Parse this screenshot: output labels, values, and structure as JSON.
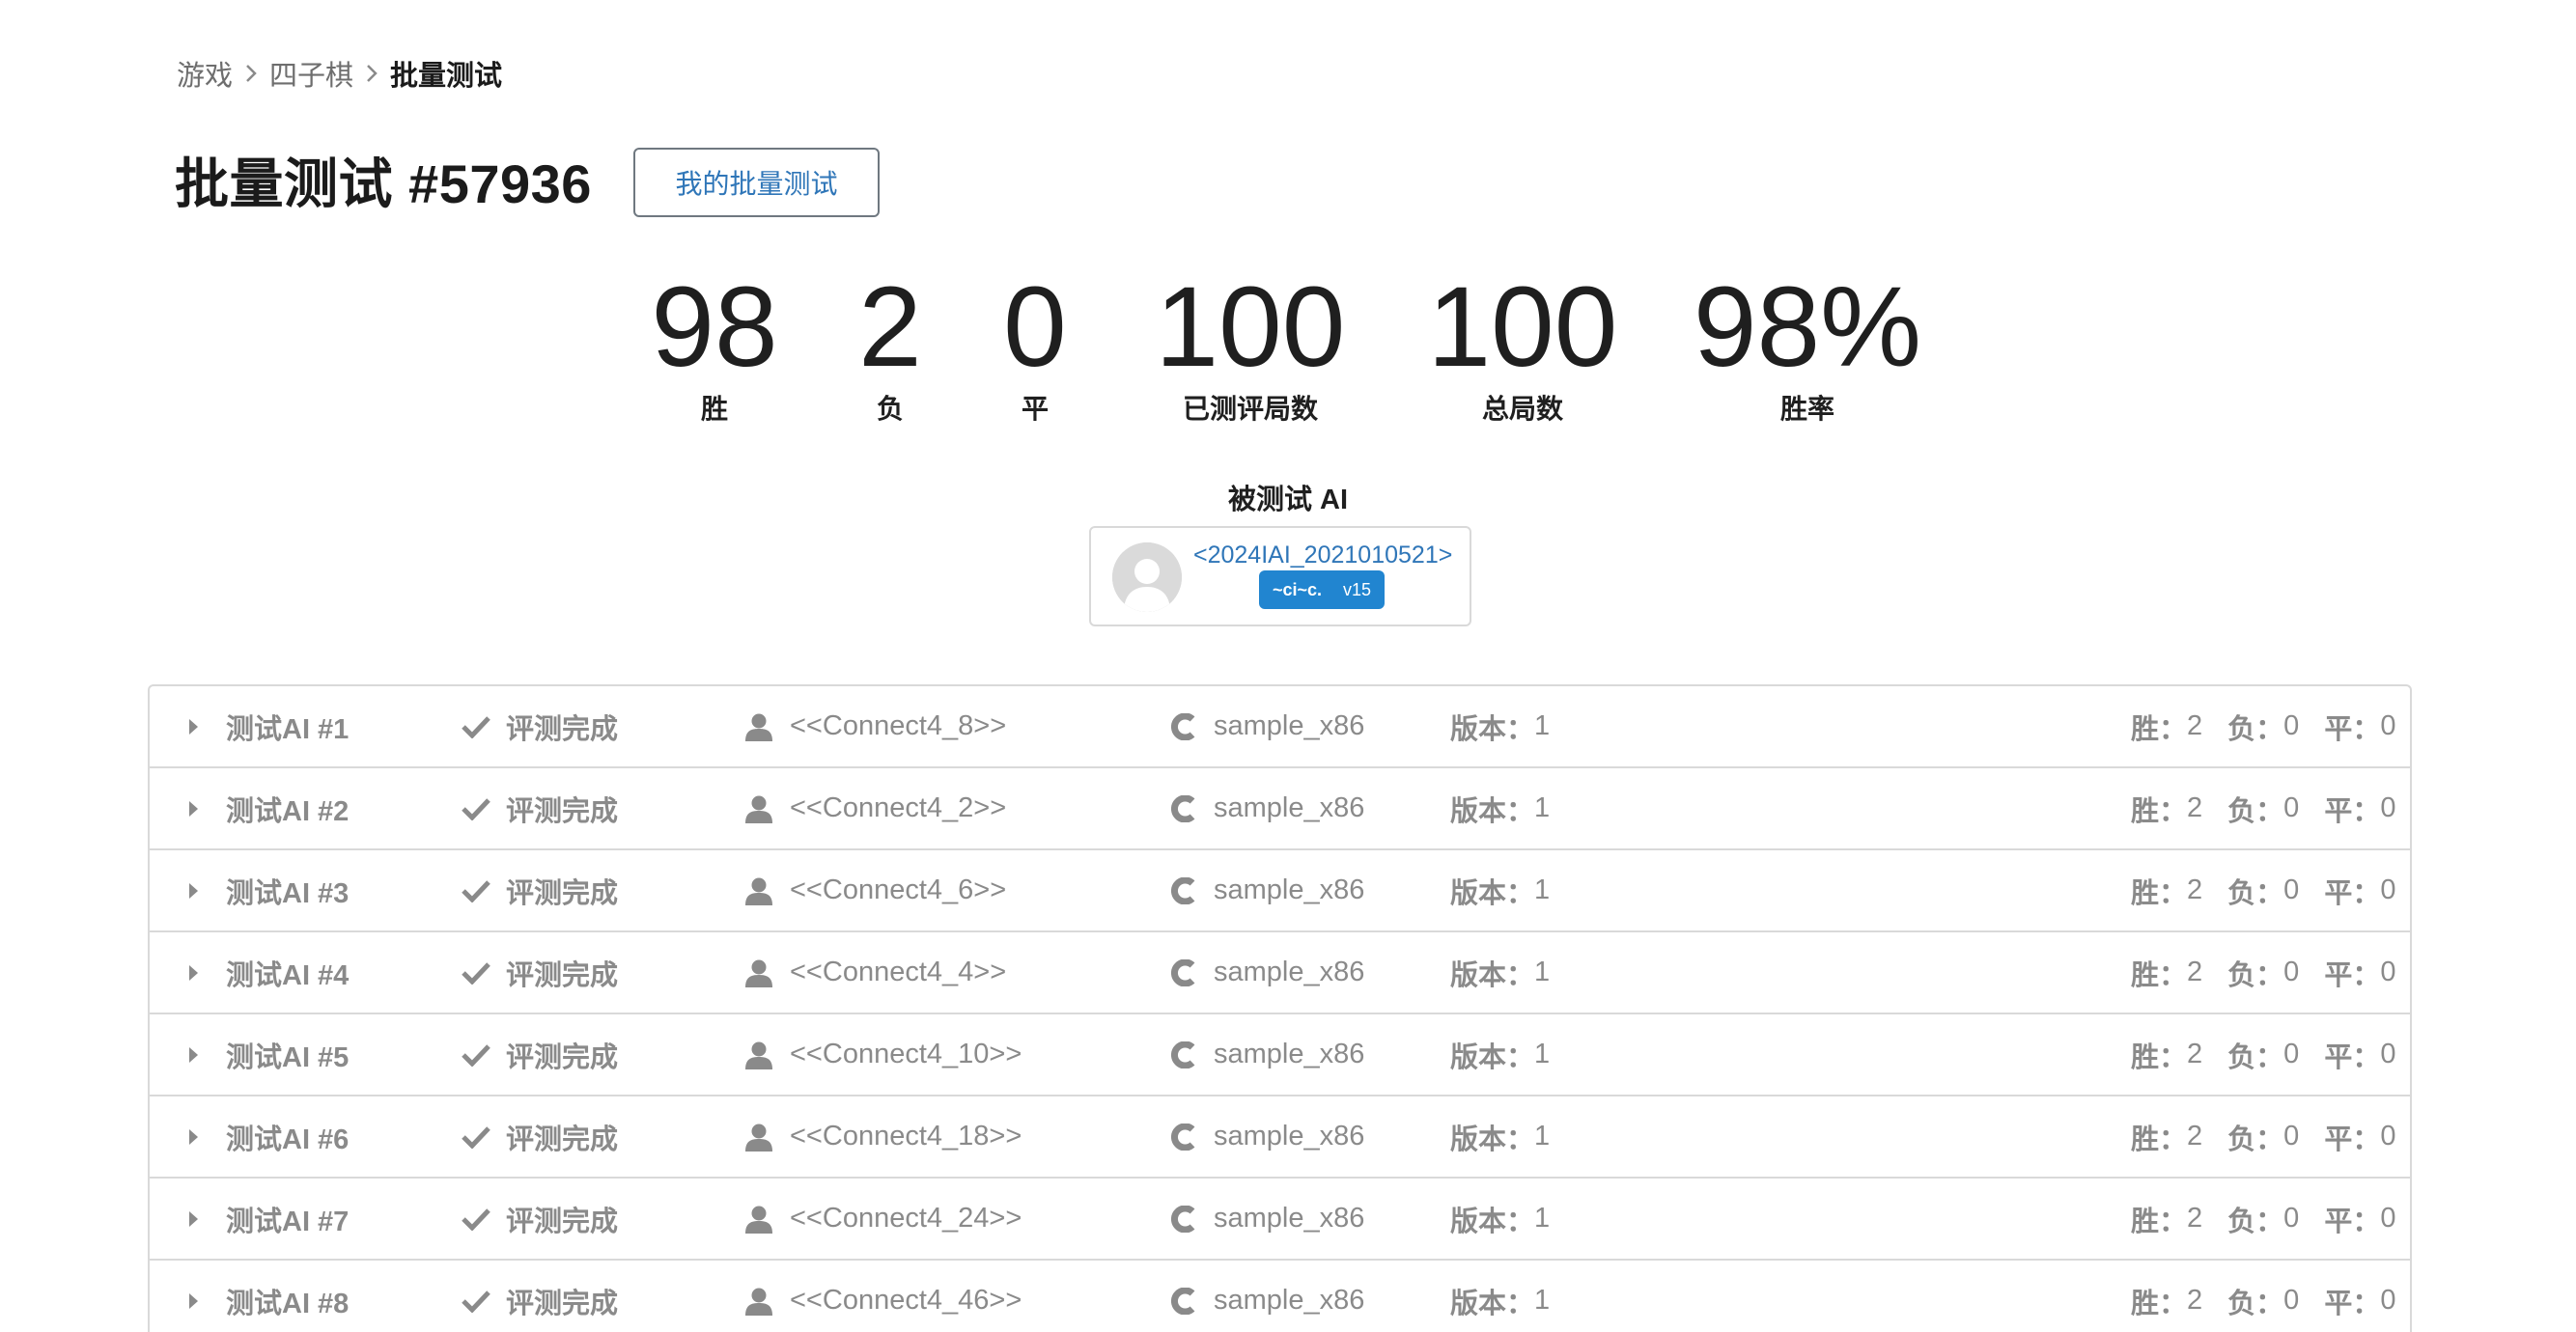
{
  "breadcrumb": {
    "items": [
      "游戏",
      "四子棋",
      "批量测试"
    ]
  },
  "header": {
    "title": "批量测试 #57936",
    "my_tests_label": "我的批量测试"
  },
  "stats": [
    {
      "value": "98",
      "label": "胜"
    },
    {
      "value": "2",
      "label": "负"
    },
    {
      "value": "0",
      "label": "平"
    },
    {
      "value": "100",
      "label": "已测评局数"
    },
    {
      "value": "100",
      "label": "总局数"
    },
    {
      "value": "98%",
      "label": "胜率"
    }
  ],
  "tested_ai": {
    "heading": "被测试 AI",
    "name": "<2024IAI_2021010521>",
    "tag": "~ci~c.",
    "version": "v15"
  },
  "colors": {
    "link": "#2f76b8",
    "tag_bg": "#2185d0",
    "muted_text": "#8a8a8a",
    "border": "#d9d9d9"
  },
  "rows": [
    {
      "label": "测试AI #1",
      "status": "评测完成",
      "opponent": "<<Connect4_8>>",
      "lang": "sample_x86",
      "version_label": "版本：",
      "version": "1",
      "win_label": "胜：",
      "win": "2",
      "lose_label": "负：",
      "lose": "0",
      "draw_label": "平：",
      "draw": "0"
    },
    {
      "label": "测试AI #2",
      "status": "评测完成",
      "opponent": "<<Connect4_2>>",
      "lang": "sample_x86",
      "version_label": "版本：",
      "version": "1",
      "win_label": "胜：",
      "win": "2",
      "lose_label": "负：",
      "lose": "0",
      "draw_label": "平：",
      "draw": "0"
    },
    {
      "label": "测试AI #3",
      "status": "评测完成",
      "opponent": "<<Connect4_6>>",
      "lang": "sample_x86",
      "version_label": "版本：",
      "version": "1",
      "win_label": "胜：",
      "win": "2",
      "lose_label": "负：",
      "lose": "0",
      "draw_label": "平：",
      "draw": "0"
    },
    {
      "label": "测试AI #4",
      "status": "评测完成",
      "opponent": "<<Connect4_4>>",
      "lang": "sample_x86",
      "version_label": "版本：",
      "version": "1",
      "win_label": "胜：",
      "win": "2",
      "lose_label": "负：",
      "lose": "0",
      "draw_label": "平：",
      "draw": "0"
    },
    {
      "label": "测试AI #5",
      "status": "评测完成",
      "opponent": "<<Connect4_10>>",
      "lang": "sample_x86",
      "version_label": "版本：",
      "version": "1",
      "win_label": "胜：",
      "win": "2",
      "lose_label": "负：",
      "lose": "0",
      "draw_label": "平：",
      "draw": "0"
    },
    {
      "label": "测试AI #6",
      "status": "评测完成",
      "opponent": "<<Connect4_18>>",
      "lang": "sample_x86",
      "version_label": "版本：",
      "version": "1",
      "win_label": "胜：",
      "win": "2",
      "lose_label": "负：",
      "lose": "0",
      "draw_label": "平：",
      "draw": "0"
    },
    {
      "label": "测试AI #7",
      "status": "评测完成",
      "opponent": "<<Connect4_24>>",
      "lang": "sample_x86",
      "version_label": "版本：",
      "version": "1",
      "win_label": "胜：",
      "win": "2",
      "lose_label": "负：",
      "lose": "0",
      "draw_label": "平：",
      "draw": "0"
    },
    {
      "label": "测试AI #8",
      "status": "评测完成",
      "opponent": "<<Connect4_46>>",
      "lang": "sample_x86",
      "version_label": "版本：",
      "version": "1",
      "win_label": "胜：",
      "win": "2",
      "lose_label": "负：",
      "lose": "0",
      "draw_label": "平：",
      "draw": "0"
    }
  ]
}
